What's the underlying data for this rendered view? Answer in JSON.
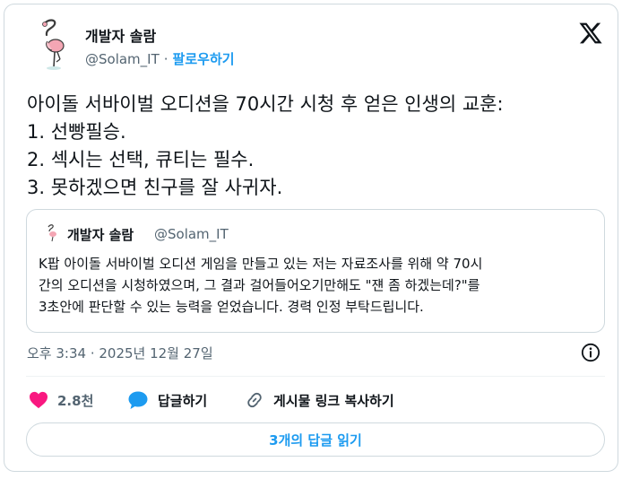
{
  "header": {
    "author_name": "개발자 솔람",
    "handle": "@Solam_IT",
    "separator": "·",
    "follow_label": "팔로우하기",
    "logo_icon": "x-logo-icon"
  },
  "tweet": {
    "lines": [
      "아이돌 서바이벌 오디션을 70시간 시청 후 얻은 인생의 교훈:",
      "1. 선빵필승.",
      "2. 섹시는 선택, 큐티는 필수.",
      "3. 못하겠으면 친구를 잘 사귀자."
    ]
  },
  "quote": {
    "author_name": "개발자 솔람",
    "handle": "@Solam_IT",
    "lines": [
      "K팝 아이돌 서바이벌 오디션 게임을 만들고 있는 저는 자료조사를 위해 약 70시",
      "간의 오디션을 시청하였으며, 그 결과 걸어들어오기만해도 \"쟨 좀 하겠는데?\"를",
      "3초안에 판단할 수 있는 능력을 얻었습니다. 경력 인정 부탁드립니다."
    ]
  },
  "meta": {
    "timestamp": "오후 3:34 · 2025년 12월 27일",
    "info_icon": "info-icon"
  },
  "actions": {
    "like_count": "2.8천",
    "reply_label": "답글하기",
    "copy_link_label": "게시물 링크 복사하기"
  },
  "read_replies_label": "3개의 답글 읽기",
  "colors": {
    "accent": "#1d9bf0",
    "like": "#f91880",
    "text": "#0f1419",
    "muted": "#536471",
    "border": "#cfd9de"
  }
}
